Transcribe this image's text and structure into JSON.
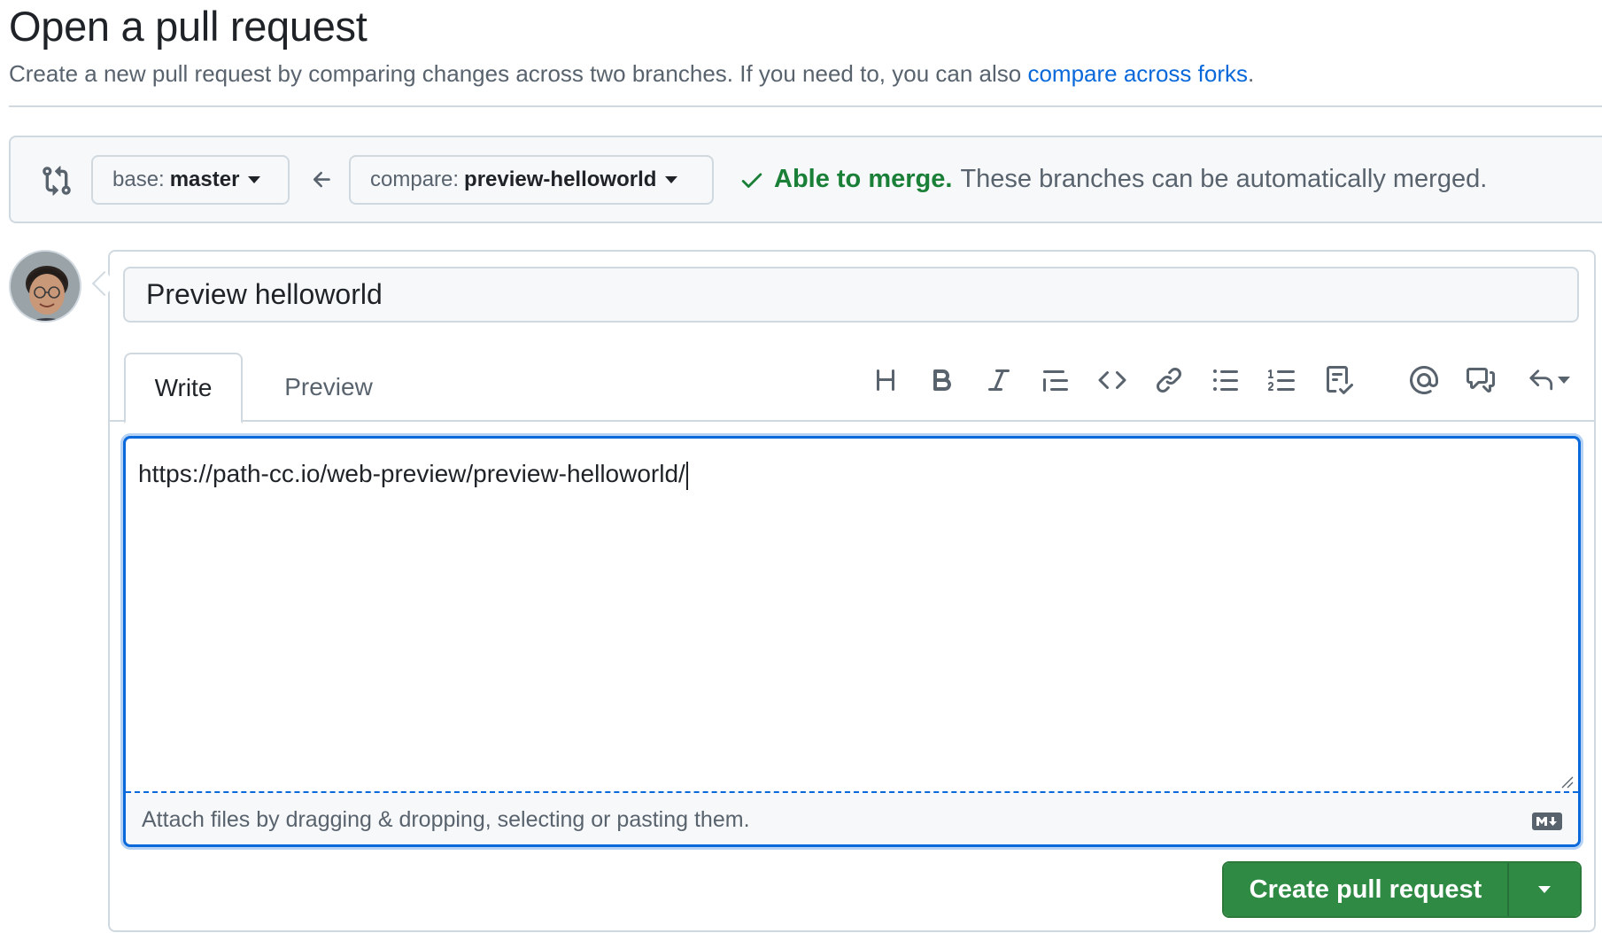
{
  "header": {
    "title": "Open a pull request",
    "subtitle_text": "Create a new pull request by comparing changes across two branches. If you need to, you can also",
    "subtitle_link": "compare across forks",
    "subtitle_end": "."
  },
  "range": {
    "base_prefix": "base:",
    "base_branch": "master",
    "compare_prefix": "compare:",
    "compare_branch": "preview-helloworld",
    "merge_ok": "Able to merge.",
    "merge_msg": "These branches can be automatically merged."
  },
  "form": {
    "title_value": "Preview helloworld",
    "tabs": [
      {
        "label": "Write"
      },
      {
        "label": "Preview"
      }
    ],
    "toolbar_icons": [
      "heading-icon",
      "bold-icon",
      "italic-icon",
      "quote-icon",
      "code-icon",
      "link-icon",
      "unordered-list-icon",
      "ordered-list-icon",
      "task-list-icon",
      "mention-icon",
      "reference-icon",
      "saved-replies-icon"
    ],
    "body_value": "https://path-cc.io/web-preview/preview-helloworld/",
    "attach_text": "Attach files by dragging & dropping, selecting or pasting them.",
    "submit_label": "Create pull request"
  },
  "colors": {
    "accent": "#0969da",
    "success": "#1a7f37",
    "button_green": "#2f8a44",
    "border": "#d1d9e0",
    "muted": "#59636e"
  }
}
